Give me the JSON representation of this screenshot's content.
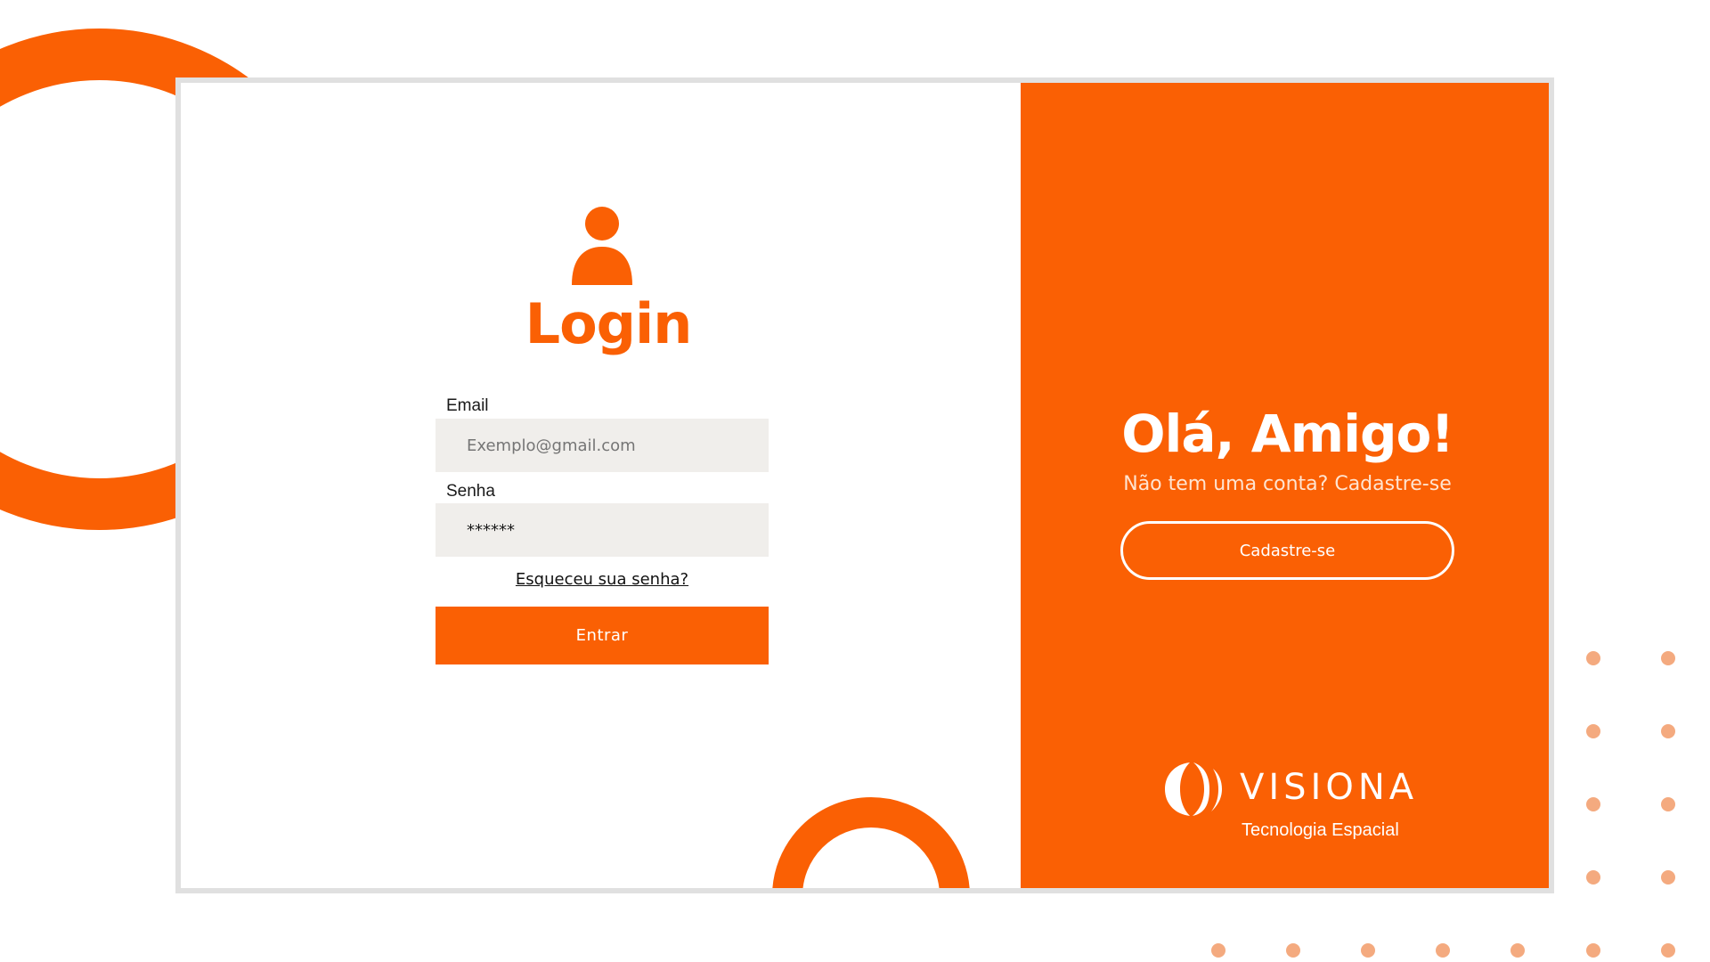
{
  "login": {
    "title": "Login",
    "email_label": "Email",
    "email_placeholder": "Exemplo@gmail.com",
    "password_label": "Senha",
    "password_value": "******",
    "forgot_link": "Esqueceu sua senha?",
    "submit_label": "Entrar"
  },
  "signup_panel": {
    "heading": "Olá, Amigo!",
    "subheading": "Não tem uma conta? Cadastre-se",
    "signup_button": "Cadastre-se"
  },
  "brand": {
    "name": "VISIONA",
    "tagline": "Tecnologia Espacial"
  },
  "colors": {
    "accent": "#FA6004",
    "input_bg": "#F0EEEB",
    "dot": "#F4AA7F",
    "card_border": "#E0E0E0"
  },
  "icons": {
    "user": "user-icon",
    "logo": "visiona-logo-icon"
  }
}
